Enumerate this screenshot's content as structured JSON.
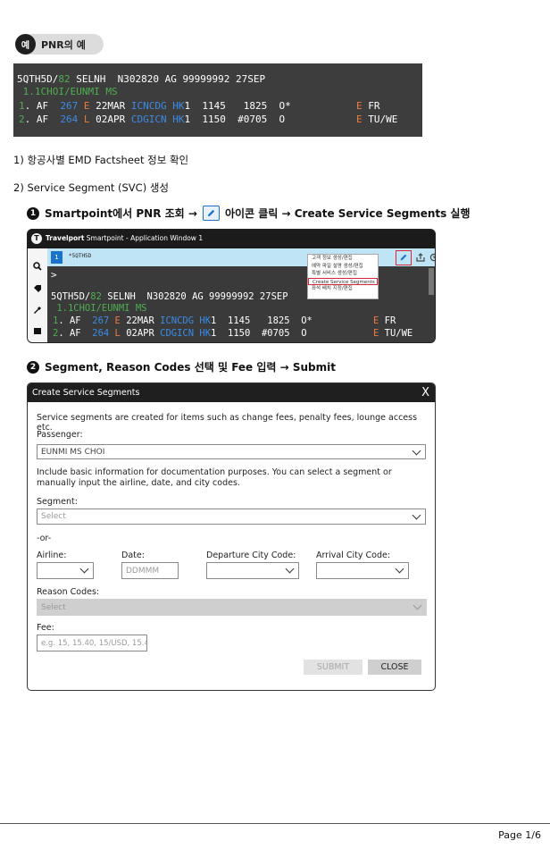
{
  "example": {
    "badge": "예",
    "title": "PNR의 예"
  },
  "pnr": {
    "l1a": "5QTH5D/",
    "l1b": "82",
    "l1c": " SELNH  N302820 AG 99999992 27SEP",
    "l2": " 1.1CHOI/EUNMI MS",
    "r1": [
      "1",
      ". AF  ",
      "267",
      " E ",
      "22MAR ",
      "ICNCDG",
      " HK",
      "1  1145   1825  O*",
      "E",
      " FR"
    ],
    "r2": [
      "2",
      ". AF  ",
      "264",
      " L ",
      "02APR ",
      "CDGICN",
      " HK",
      "1  1150  #0705  O",
      "E",
      " TU/WE"
    ]
  },
  "steps": {
    "s1": "1) 항공사별 EMD Factsheet 정보 확인",
    "s2": "2) Service Segment (SVC) 생성",
    "sub1_num": "1",
    "sub1_a": "Smartpoint에서 PNR 조회 →",
    "sub1_b": "아이콘 클릭 → Create Service Segments 실행",
    "sub2_num": "2",
    "sub2": "Segment, Reason Codes 선택 및 Fee 입력 → Submit"
  },
  "smartpoint": {
    "app_title_bold": "Travelport",
    "app_title_rest": " Smartpoint - Application Window 1",
    "tab_num": "1",
    "tab_label": "*5QTH5D",
    "prompt": ">",
    "menu": [
      "고객 정보 생성/편집",
      "예약 파일 설명 생성/편집",
      "특별 서비스 생성/편집",
      "Create Service Segments",
      "좌석 배치 지정/편집"
    ],
    "selected_menu_index": 3
  },
  "dialog": {
    "title": "Create Service Segments",
    "close": "X",
    "intro": "Service segments are created for items such as change fees, penalty fees, lounge access etc.",
    "passenger_label": "Passenger:",
    "passenger_value": "EUNMI MS CHOI",
    "info": "Include basic information for documentation purposes. You can select a segment or manually input the airline, date, and city codes.",
    "segment_label": "Segment:",
    "segment_placeholder": "Select",
    "or": "-or-",
    "airline_label": "Airline:",
    "date_label": "Date:",
    "date_placeholder": "DDMMM",
    "dep_label": "Departure City Code:",
    "arr_label": "Arrival City Code:",
    "reason_label": "Reason Codes:",
    "reason_placeholder": "Select",
    "fee_label": "Fee:",
    "fee_placeholder": "e.g. 15, 15.40, 15/USD, 15.4(",
    "submit": "SUBMIT",
    "close_btn": "CLOSE"
  },
  "page": "Page 1/6"
}
